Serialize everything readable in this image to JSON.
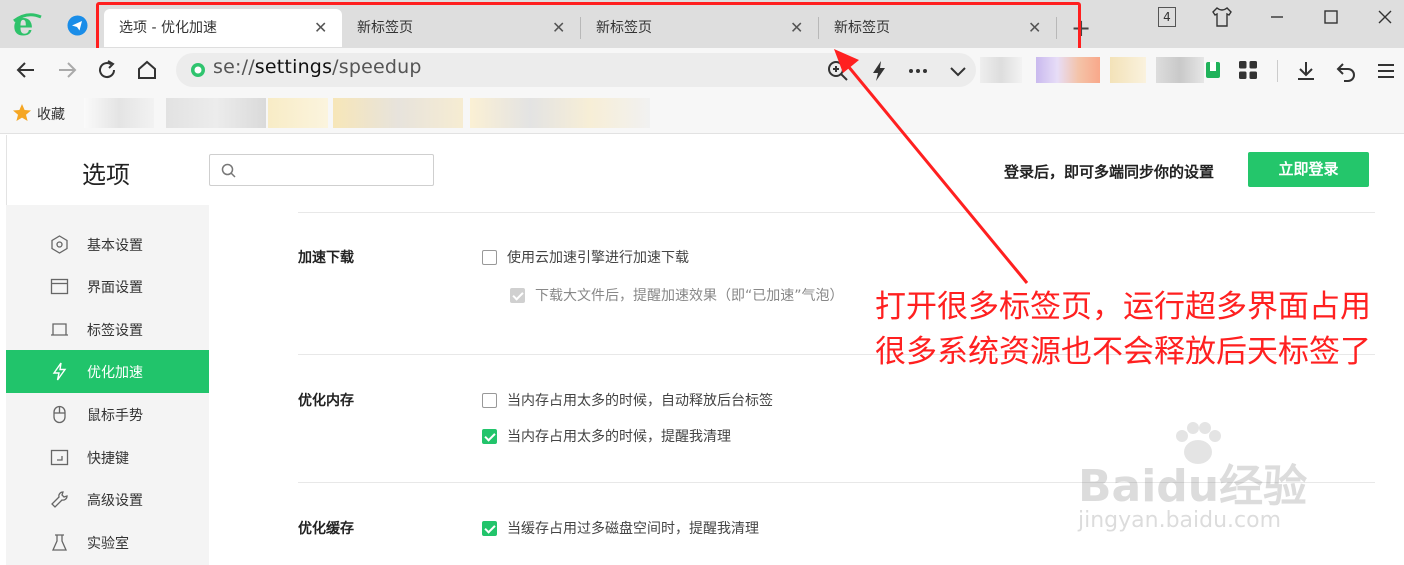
{
  "tabs": [
    {
      "label": "选项 - 优化加速",
      "active": true
    },
    {
      "label": "新标签页",
      "active": false
    },
    {
      "label": "新标签页",
      "active": false
    },
    {
      "label": "新标签页",
      "active": false
    }
  ],
  "tab_close_glyph": "✕",
  "new_tab_glyph": "+",
  "tab_count": "4",
  "address": {
    "url": "se://settings/speedup",
    "prefix": "se://",
    "path_bold": "settings",
    "suffix": "/speedup"
  },
  "bookmarks": {
    "label": "收藏"
  },
  "settings": {
    "title": "选项",
    "search_placeholder": "",
    "sync_text": "登录后，即可多端同步你的设置",
    "login_button": "立即登录"
  },
  "sidebar": {
    "items": [
      {
        "label": "基本设置",
        "icon": "hexagon-icon",
        "active": false
      },
      {
        "label": "界面设置",
        "icon": "window-icon",
        "active": false
      },
      {
        "label": "标签设置",
        "icon": "tab-icon",
        "active": false
      },
      {
        "label": "优化加速",
        "icon": "lightning-icon",
        "active": true
      },
      {
        "label": "鼠标手势",
        "icon": "mouse-icon",
        "active": false
      },
      {
        "label": "快捷键",
        "icon": "shortcut-icon",
        "active": false
      },
      {
        "label": "高级设置",
        "icon": "wrench-icon",
        "active": false
      },
      {
        "label": "实验室",
        "icon": "flask-icon",
        "active": false
      }
    ]
  },
  "sections": [
    {
      "label": "加速下载",
      "options": [
        {
          "text": "使用云加速引擎进行加速下载",
          "checked": false,
          "disabled": false
        },
        {
          "text": "下载大文件后，提醒加速效果（即“已加速”气泡）",
          "checked": true,
          "disabled": true
        }
      ]
    },
    {
      "label": "优化内存",
      "options": [
        {
          "text": "当内存占用太多的时候，自动释放后台标签",
          "checked": false,
          "disabled": false
        },
        {
          "text": "当内存占用太多的时候，提醒我清理",
          "checked": true,
          "disabled": false
        }
      ]
    },
    {
      "label": "优化缓存",
      "options": [
        {
          "text": "当缓存占用过多磁盘空间时，提醒我清理",
          "checked": true,
          "disabled": false
        }
      ]
    }
  ],
  "annotation": "打开很多标签页，运行超多界面占用很多系统资源也不会释放后天标签了",
  "watermark": {
    "brand": "Baidu经验",
    "url": "jingyan.baidu.com"
  },
  "colors": {
    "accent": "#21c46b",
    "annotation": "#ff2020",
    "tabstrip": "#dedede"
  }
}
